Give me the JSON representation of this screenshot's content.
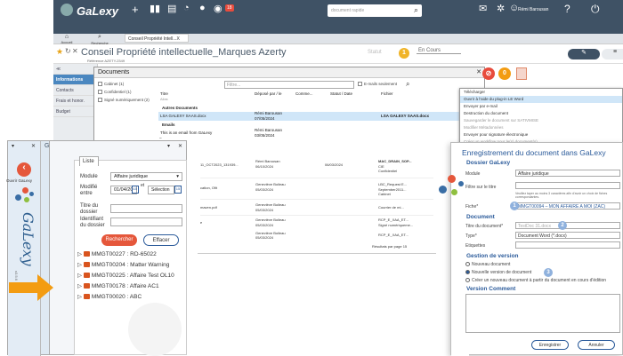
{
  "app": {
    "name": "GaLexy",
    "search_placeholder": "document rapide",
    "user": "Rémi Barousan",
    "notif_badge": "18"
  },
  "ribbon": {
    "b1": "Accueil",
    "b2": "Recherche",
    "tab": "Conseil Propriété Intell...X"
  },
  "doc": {
    "title": "Conseil Propriété intellectuelle_Marques Azerty",
    "reference": "Référence AZETY-2349",
    "status_label": "Statut",
    "status_value": "En Cours",
    "circle_num": "1"
  },
  "leftnav": {
    "items": [
      "≪",
      "Informations",
      "Contacts",
      "Frais et honor.",
      "Budget"
    ]
  },
  "documents": {
    "title": "Documents",
    "filters": [
      "Cabinet (1)",
      "Confidentiel (1)",
      "Signé numériquement (2)"
    ],
    "filter_placeholder": "Filtre...",
    "emails_only": "E-mails seulement",
    "cols": [
      "Titre",
      "Déposé par / le",
      "Comme...",
      "Statut / Date",
      "Fichier"
    ],
    "col_sub": "Alias",
    "group1": "Autres Documents",
    "row1": {
      "title": "LSA GALEXY SAAS.docx",
      "by": "Rémi Barousan",
      "date": "07/05/2024",
      "file": "LSA GALEXY SAAS.docx"
    },
    "group2": "Emails",
    "row2": {
      "title": "This is an email from GaLexy",
      "by": "Rémi Barousan",
      "date": "03/05/2024"
    }
  },
  "context_menu": [
    "Télécharger",
    "Ouvrir à l'aide du plug-in LE Word",
    "Envoyer par e-mail",
    "Destruction du document",
    "Sauvegarder le document sur SATIVMISE",
    "Modifier Métadonnées",
    "Envoyer pour signature électronique",
    "Créer un workflow pour le(s) document(s)"
  ],
  "lower_rows": [
    {
      "c1": "11_OCT2023_131939...",
      "c2": "Rémi Barousan",
      "c3": "06/10/2024",
      "c4": "06/03/2024",
      "c5": "MAC_DRAIN_SOP...",
      "c6": "CIE",
      "c7": "Confidentiel"
    },
    {
      "c1": "cation, Ofit",
      "c2": "Geneviève Boileau",
      "c3": "05/03/2024",
      "c5": "LBC_Request E...",
      "c6": "September2011...",
      "c7": "Cabinet"
    },
    {
      "c1": "maven.pdf",
      "c2": "Geneviève Boileau",
      "c3": "05/03/2024",
      "c5": "Courrier de mi..."
    },
    {
      "c1": "e",
      "c2": "Geneviève Boileau",
      "c3": "05/03/2024",
      "c5": "RCP_E_XAA_ET...",
      "c6": "Signé numériqueme..."
    },
    {
      "c2": "Geneviève Boileau",
      "c3": "05/03/2024",
      "c5": "RCP_E_XAA_ET..."
    }
  ],
  "results_label": "Résultats par page 15",
  "sidebar": {
    "title": "GaLexy",
    "vtext": "GaLexy",
    "small": "v3.5.6",
    "ouvrir": "Ouvrir GaLexy"
  },
  "panel": {
    "tab": "Liste",
    "module_label": "Module",
    "module_value": "Affaire juridique",
    "modifie_label": "Modifié entre",
    "date_value": "01/04/20",
    "et": "et",
    "selection": "Sélection",
    "titre_label": "Titre du dossier",
    "ident_label": "Identifiant du dossier",
    "search_btn": "Rechercher",
    "clear_btn": "Effacer",
    "tree": [
      "MMGT00227 : RD-65022",
      "MMGT00204 : Matter Warning",
      "MMGT00225 : Affaire Test OL10",
      "MMGT00178 : Affaire AC1",
      "MMGT00020 : ABC"
    ]
  },
  "enr": {
    "title": "Enregistrement du document dans GaLexy",
    "s1": "Dossier GaLexy",
    "module_label": "Module",
    "module_value": "Affaire juridique",
    "filtre_label": "Filtre sur le titre",
    "hint": "Veuillez taper au moins 3 caractères afin d'avoir un choix de fiches correspondantes.",
    "fiche_label": "Fiche*",
    "fiche_value": "MMGT00094 – MON AFFAIRE A MOI (ZAC)",
    "fiche_num": "1",
    "s2": "Document",
    "titre_label": "Titre du document*",
    "titre_value": "TestDoc 31.docx",
    "titre_num": "2",
    "type_label": "Type*",
    "type_value": "Document Word (*.docx)",
    "etiq_label": "Etiquettes",
    "s3": "Gestion de version",
    "r1": "Nouveau document",
    "r2": "Nouvelle version de document",
    "r2_num": "3",
    "r3": "Créer un nouveau document à partir du document en cours d'édition",
    "s4": "Version Comment",
    "save": "Enregistrer",
    "cancel": "Annuler"
  }
}
